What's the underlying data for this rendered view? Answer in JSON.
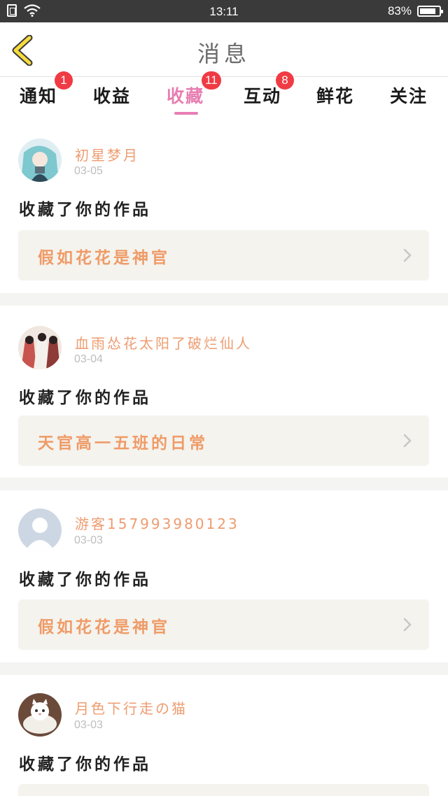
{
  "status_bar": {
    "time": "13:11",
    "battery": "83%",
    "battery_level": 0.83
  },
  "header": {
    "title": "消息",
    "back_icon": "chevron-left-icon"
  },
  "tabs": [
    {
      "label": "通知",
      "badge": "1"
    },
    {
      "label": "收益",
      "badge": ""
    },
    {
      "label": "收藏",
      "badge": "11",
      "active": true
    },
    {
      "label": "互动",
      "badge": "8"
    },
    {
      "label": "鲜花",
      "badge": ""
    },
    {
      "label": "关注",
      "badge": ""
    }
  ],
  "feed": [
    {
      "username": "初星梦月",
      "date": "03-05",
      "action": "收藏了你的作品",
      "work_title": "假如花花是神官"
    },
    {
      "username": "血雨怂花太阳了破烂仙人",
      "date": "03-04",
      "action": "收藏了你的作品",
      "work_title": "天官高一五班的日常"
    },
    {
      "username": "游客157993980123",
      "date": "03-03",
      "action": "收藏了你的作品",
      "work_title": "假如花花是神官"
    },
    {
      "username": "月色下行走の猫",
      "date": "03-03",
      "action": "收藏了你的作品",
      "work_title": ""
    }
  ],
  "colors": {
    "accent_pink": "#e77eb1",
    "username_orange": "#ee9c70",
    "work_title_orange": "#ef9b67",
    "badge_red": "#f03a44",
    "back_arrow_yellow": "#f6dc3c"
  }
}
